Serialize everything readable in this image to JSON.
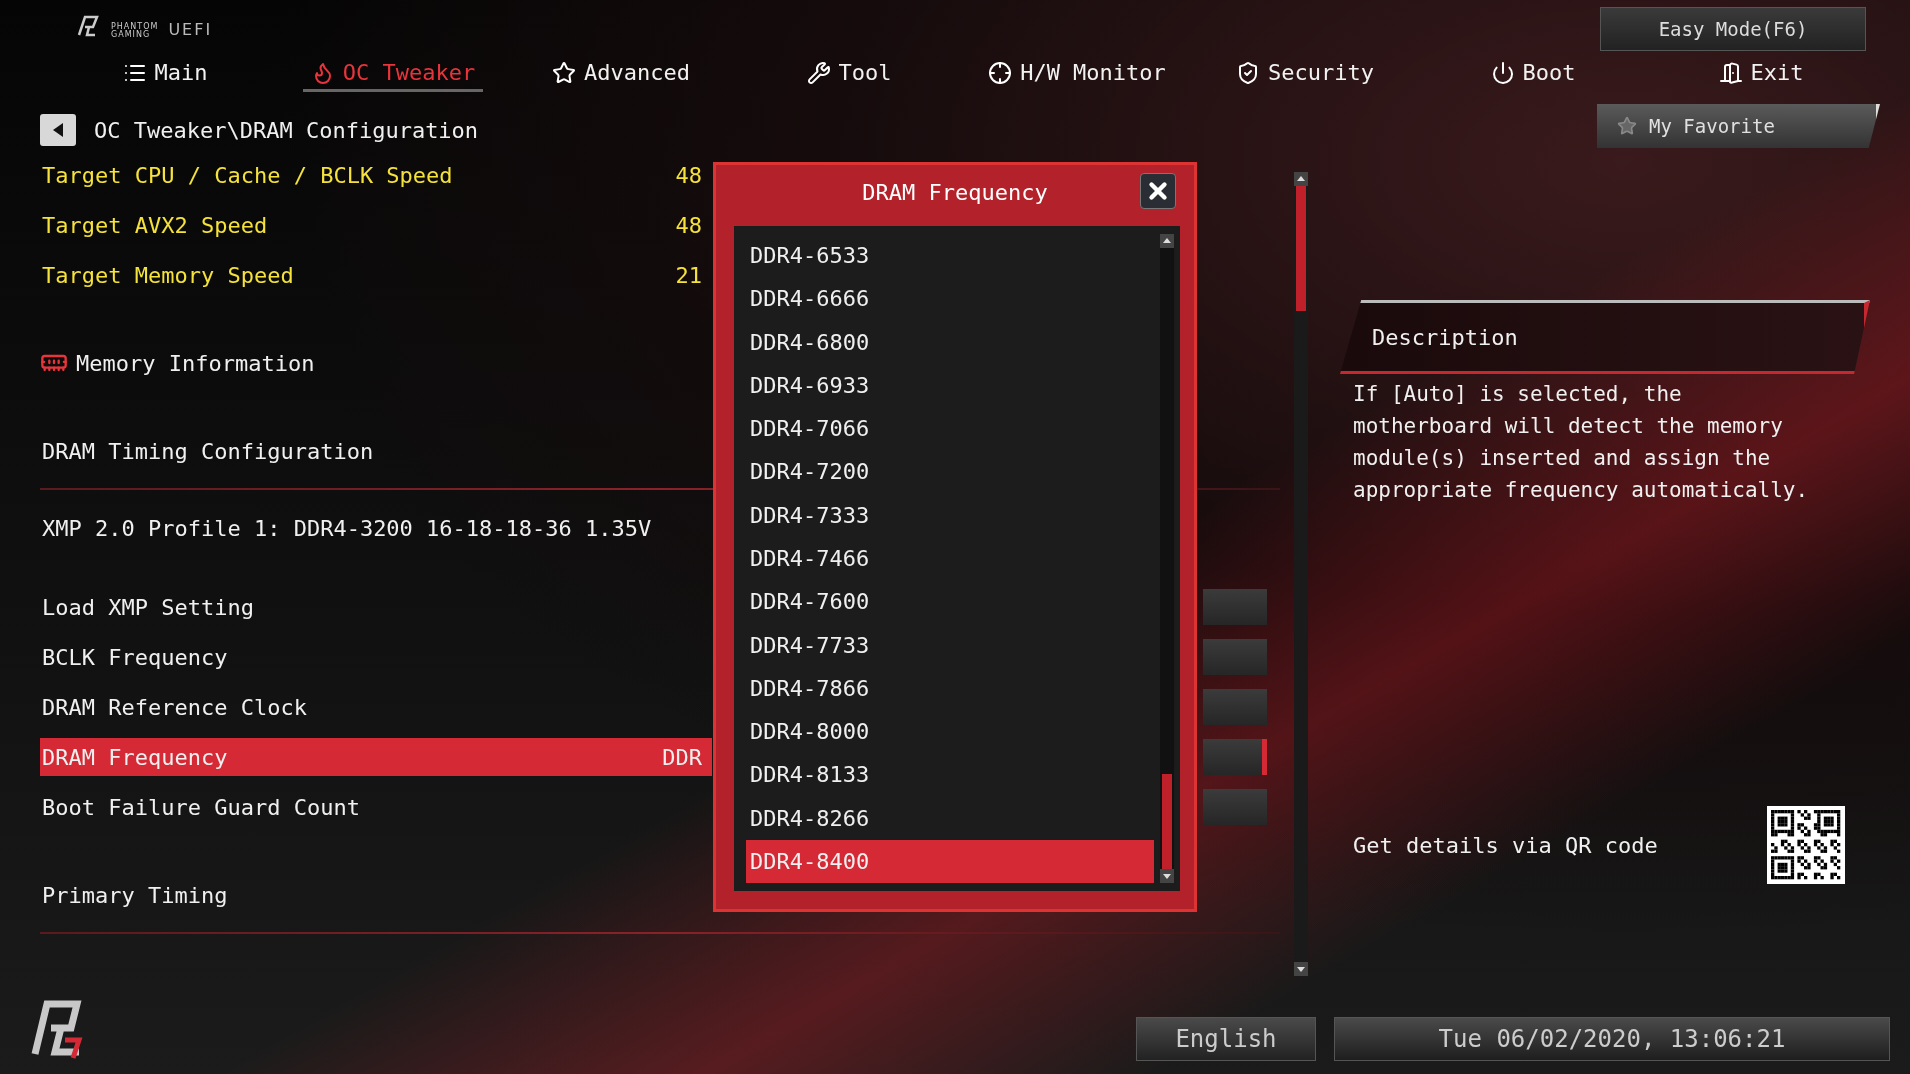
{
  "logo": {
    "brand_top": "PHANTOM",
    "brand_bottom": "GAMING",
    "product": "UEFI"
  },
  "easy_mode_button": "Easy Mode(F6)",
  "tabs": [
    {
      "label": "Main",
      "selected": false
    },
    {
      "label": "OC Tweaker",
      "selected": true
    },
    {
      "label": "Advanced",
      "selected": false
    },
    {
      "label": "Tool",
      "selected": false
    },
    {
      "label": "H/W Monitor",
      "selected": false
    },
    {
      "label": "Security",
      "selected": false
    },
    {
      "label": "Boot",
      "selected": false
    },
    {
      "label": "Exit",
      "selected": false
    }
  ],
  "breadcrumb": "OC Tweaker\\DRAM Configuration",
  "my_favorite_button": "My Favorite",
  "settings": [
    {
      "kind": "info",
      "label": "Target CPU / Cache / BCLK Speed",
      "value": "48",
      "color": "#f5e23a",
      "selected": false
    },
    {
      "kind": "info",
      "label": "Target AVX2 Speed",
      "value": "48",
      "color": "#f5e23a",
      "selected": false
    },
    {
      "kind": "info",
      "label": "Target Memory Speed",
      "value": "21",
      "color": "#f5e23a",
      "selected": false
    },
    {
      "kind": "section",
      "label": "Memory Information",
      "selected": false
    },
    {
      "kind": "heading",
      "label": "DRAM Timing Configuration",
      "selected": false
    },
    {
      "kind": "text",
      "label": "XMP 2.0 Profile 1: DDR4-3200 16-18-18-36 1.35V",
      "selected": false
    },
    {
      "kind": "option",
      "label": "Load XMP Setting",
      "selected": false
    },
    {
      "kind": "option",
      "label": "BCLK Frequency",
      "selected": false
    },
    {
      "kind": "option",
      "label": "DRAM Reference Clock",
      "selected": false
    },
    {
      "kind": "option",
      "label": "DRAM Frequency",
      "value": "DDR",
      "selected": true
    },
    {
      "kind": "option",
      "label": "Boot Failure Guard Count",
      "selected": false
    },
    {
      "kind": "heading",
      "label": "Primary Timing",
      "selected": false
    }
  ],
  "dialog": {
    "title": "DRAM Frequency",
    "options": [
      {
        "label": "DDR4-6533",
        "selected": false
      },
      {
        "label": "DDR4-6666",
        "selected": false
      },
      {
        "label": "DDR4-6800",
        "selected": false
      },
      {
        "label": "DDR4-6933",
        "selected": false
      },
      {
        "label": "DDR4-7066",
        "selected": false
      },
      {
        "label": "DDR4-7200",
        "selected": false
      },
      {
        "label": "DDR4-7333",
        "selected": false
      },
      {
        "label": "DDR4-7466",
        "selected": false
      },
      {
        "label": "DDR4-7600",
        "selected": false
      },
      {
        "label": "DDR4-7733",
        "selected": false
      },
      {
        "label": "DDR4-7866",
        "selected": false
      },
      {
        "label": "DDR4-8000",
        "selected": false
      },
      {
        "label": "DDR4-8133",
        "selected": false
      },
      {
        "label": "DDR4-8266",
        "selected": false
      },
      {
        "label": "DDR4-8400",
        "selected": true
      }
    ]
  },
  "description": {
    "title": "Description",
    "text": "If [Auto] is selected, the motherboard will detect the memory module(s) inserted and assign the appropriate frequency automatically.",
    "qr_label": "Get details via QR code"
  },
  "footer": {
    "language": "English",
    "datetime": "Tue 06/02/2020, 13:06:21"
  }
}
